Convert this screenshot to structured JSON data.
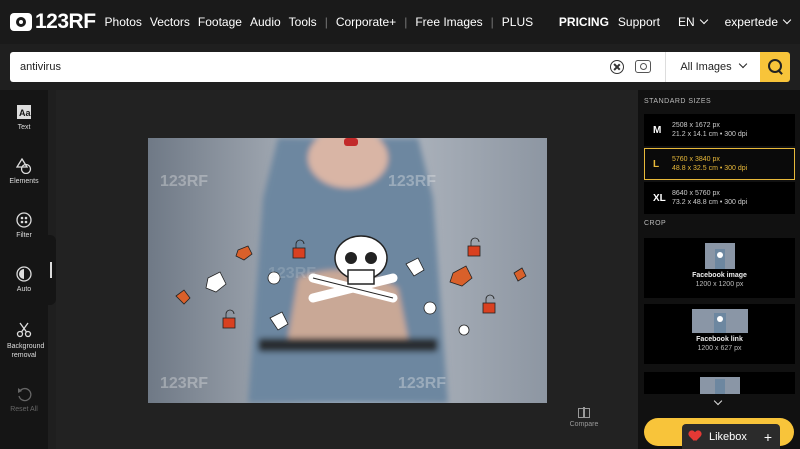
{
  "header": {
    "logo_text": "123RF",
    "nav": [
      "Photos",
      "Vectors",
      "Footage",
      "Audio",
      "Tools",
      "Corporate+",
      "Free Images",
      "PLUS"
    ],
    "pricing": "PRICING",
    "support": "Support",
    "language": "EN",
    "username": "expertede"
  },
  "search": {
    "value": "antivirus",
    "type_label": "All Images"
  },
  "tools": [
    {
      "label": "Text",
      "icon": "text-icon"
    },
    {
      "label": "Elements",
      "icon": "shapes-icon"
    },
    {
      "label": "Filter",
      "icon": "filter-icon"
    },
    {
      "label": "Auto",
      "icon": "auto-adjust-icon"
    },
    {
      "label": "Background removal",
      "icon": "scissors-icon"
    },
    {
      "label": "Reset All",
      "icon": "reset-icon"
    }
  ],
  "compare_label": "Compare",
  "panel": {
    "sizes_title": "STANDARD SIZES",
    "sizes": [
      {
        "letter": "M",
        "px": "2508 x 1672 px",
        "info": "21.2 x 14.1 cm • 300 dpi"
      },
      {
        "letter": "L",
        "px": "5760 x 3840 px",
        "info": "48.8 x 32.5 cm • 300 dpi"
      },
      {
        "letter": "XL",
        "px": "8640 x 5760 px",
        "info": "73.2 x 48.8 cm • 300 dpi"
      }
    ],
    "crop_title": "CROP",
    "crops": [
      {
        "name": "Facebook image",
        "dims": "1200 x 1200 px"
      },
      {
        "name": "Facebook link",
        "dims": "1200 x 627 px"
      }
    ]
  },
  "likebox": {
    "label": "Likebox",
    "plus": "+"
  },
  "colors": {
    "accent": "#f8c43a",
    "selected": "#e8b93a",
    "heart": "#e53935"
  }
}
